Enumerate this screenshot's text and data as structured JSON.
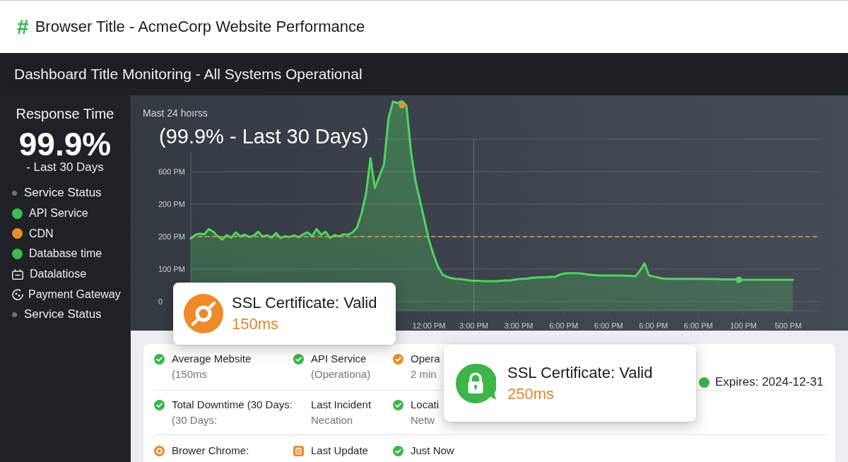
{
  "window": {
    "icon": "#",
    "title": "Browser Title - AcmeCorp Website Performance"
  },
  "dashboard": {
    "title": "Dashboard Title Monitoring - All Systems Operational"
  },
  "sidebar": {
    "heading": "Response Time",
    "metric": "99.9%",
    "caption": "- Last 30 Days",
    "items": [
      {
        "kind": "bullet",
        "label": "Service Status",
        "color": "#6e7278"
      },
      {
        "kind": "status",
        "label": "API Service",
        "color": "#3dbb4f"
      },
      {
        "kind": "status",
        "label": "CDN",
        "color": "#f08c2a"
      },
      {
        "kind": "status",
        "label": "Database time",
        "color": "#3dbb4f"
      },
      {
        "kind": "tray",
        "label": "Datalatiose"
      },
      {
        "kind": "dial",
        "label": "Payment Gateway"
      },
      {
        "kind": "bullet",
        "label": "Service Status",
        "color": "#6e7278"
      }
    ]
  },
  "chart": {
    "subtitle": "Mast 24 hoırss",
    "title": "(99.9% - Last 30 Days)",
    "y_axis_labels": [
      "600 PM",
      "200 PM",
      "200 PM",
      "100 PM",
      "0"
    ],
    "x_axis_labels": [
      "12:00 PM",
      "3:00 PM",
      "3:00 PM",
      "6:00 PM",
      "6:00 PM",
      "6:00 PM",
      "6:00 PM",
      "100 PM",
      "500 PM"
    ]
  },
  "status_table": {
    "rows": [
      {
        "cells": [
          {
            "kind": "check",
            "color": "#3cb54a",
            "title": "Average Mebsite",
            "subtitle": "(150ms"
          },
          {
            "kind": "check",
            "color": "#3cb54a",
            "title": "API Service",
            "subtitle": "(Operationa)"
          },
          {
            "kind": "check",
            "color": "#ee8a26",
            "title": "Opera",
            "subtitle": "2 min"
          },
          {
            "kind": "dot",
            "color": "#3cb54a",
            "title": "Expires: 2024-12-31"
          }
        ]
      },
      {
        "cells": [
          {
            "kind": "check",
            "color": "#3cb54a",
            "title": "Total Downtime (30 Days:",
            "subtitle": "(30 Days:"
          },
          {
            "kind": "none",
            "title": "Last Incident",
            "subtitle": "Necation"
          },
          {
            "kind": "check",
            "color": "#3cb54a",
            "title": "Locati",
            "subtitle": "Netw"
          }
        ]
      },
      {
        "cells": [
          {
            "kind": "ring",
            "color": "#ee8a26",
            "title": "Brower Chrome:"
          },
          {
            "kind": "doc",
            "color": "#ee8a26",
            "title": "Last Update"
          },
          {
            "kind": "check",
            "color": "#3cb54a",
            "title": "Just Now"
          }
        ]
      }
    ]
  },
  "toasts": [
    {
      "kind": "slash",
      "color": "#ef8a2b",
      "title": "SSL Certificate: Valid",
      "value": "150ms"
    },
    {
      "kind": "lock",
      "color": "#3db54a",
      "title": "SSL Certificate: Valid",
      "value": "250ms"
    }
  ]
}
